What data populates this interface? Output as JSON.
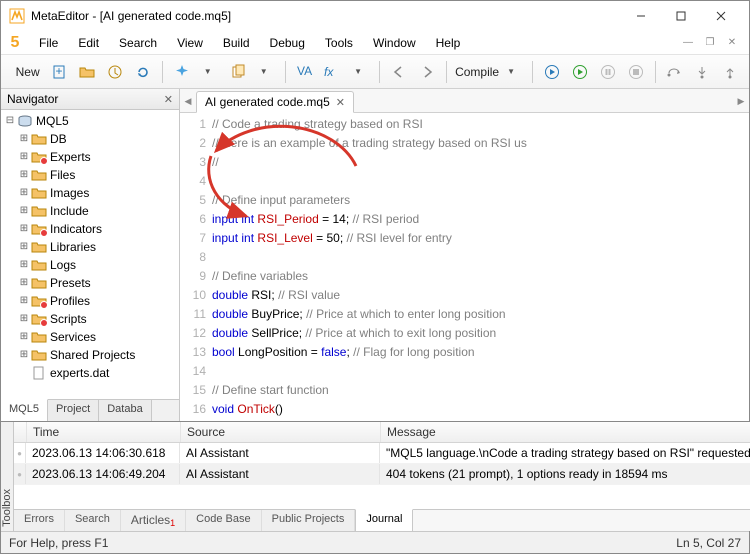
{
  "window": {
    "title": "MetaEditor - [AI generated code.mq5]"
  },
  "menus": {
    "file": "File",
    "edit": "Edit",
    "search": "Search",
    "view": "View",
    "build": "Build",
    "debug": "Debug",
    "tools": "Tools",
    "window": "Window",
    "help": "Help"
  },
  "toolbar": {
    "new": "New",
    "compile": "Compile"
  },
  "navigator": {
    "title": "Navigator",
    "root": "MQL5",
    "items": [
      {
        "label": "DB",
        "icon": "folder"
      },
      {
        "label": "Experts",
        "icon": "folder",
        "badge": true
      },
      {
        "label": "Files",
        "icon": "folder"
      },
      {
        "label": "Images",
        "icon": "folder"
      },
      {
        "label": "Include",
        "icon": "folder"
      },
      {
        "label": "Indicators",
        "icon": "folder",
        "badge": true
      },
      {
        "label": "Libraries",
        "icon": "folder"
      },
      {
        "label": "Logs",
        "icon": "folder"
      },
      {
        "label": "Presets",
        "icon": "folder"
      },
      {
        "label": "Profiles",
        "icon": "folder",
        "badge": true
      },
      {
        "label": "Scripts",
        "icon": "folder",
        "badge": true
      },
      {
        "label": "Services",
        "icon": "folder"
      },
      {
        "label": "Shared Projects",
        "icon": "folder-shared"
      },
      {
        "label": "experts.dat",
        "icon": "file"
      }
    ],
    "tabs": {
      "a": "MQL5",
      "b": "Project",
      "c": "Databa"
    }
  },
  "filetab": {
    "name": "AI generated code.mq5"
  },
  "code_lines": [
    {
      "n": 1,
      "segs": [
        {
          "t": "// Code a trading strategy based on RSI",
          "c": "comment"
        }
      ]
    },
    {
      "n": 2,
      "segs": [
        {
          "t": "// Here is an example of a trading strategy based on RSI us",
          "c": "comment"
        }
      ]
    },
    {
      "n": 3,
      "segs": [
        {
          "t": "//",
          "c": "comment"
        }
      ]
    },
    {
      "n": 4,
      "segs": []
    },
    {
      "n": 5,
      "segs": [
        {
          "t": "// Define input parameters",
          "c": "comment"
        }
      ]
    },
    {
      "n": 6,
      "segs": [
        {
          "t": "input",
          "c": "kw-blue"
        },
        {
          "t": " "
        },
        {
          "t": "int",
          "c": "kw-blue"
        },
        {
          "t": " "
        },
        {
          "t": "RSI_Period",
          "c": "kw-red"
        },
        {
          "t": " = "
        },
        {
          "t": "14",
          "c": "numlit"
        },
        {
          "t": "; "
        },
        {
          "t": "// RSI period",
          "c": "comment"
        }
      ]
    },
    {
      "n": 7,
      "segs": [
        {
          "t": "input",
          "c": "kw-blue"
        },
        {
          "t": " "
        },
        {
          "t": "int",
          "c": "kw-blue"
        },
        {
          "t": " "
        },
        {
          "t": "RSI_Level",
          "c": "kw-red"
        },
        {
          "t": " = "
        },
        {
          "t": "50",
          "c": "numlit"
        },
        {
          "t": "; "
        },
        {
          "t": "// RSI level for entry",
          "c": "comment"
        }
      ]
    },
    {
      "n": 8,
      "segs": []
    },
    {
      "n": 9,
      "segs": [
        {
          "t": "// Define variables",
          "c": "comment"
        }
      ]
    },
    {
      "n": 10,
      "segs": [
        {
          "t": "double",
          "c": "kw-blue"
        },
        {
          "t": " "
        },
        {
          "t": "RSI",
          "c": "identifier"
        },
        {
          "t": "; "
        },
        {
          "t": "// RSI value",
          "c": "comment"
        }
      ]
    },
    {
      "n": 11,
      "segs": [
        {
          "t": "double",
          "c": "kw-blue"
        },
        {
          "t": " "
        },
        {
          "t": "BuyPrice",
          "c": "identifier"
        },
        {
          "t": "; "
        },
        {
          "t": "// Price at which to enter long position",
          "c": "comment"
        }
      ]
    },
    {
      "n": 12,
      "segs": [
        {
          "t": "double",
          "c": "kw-blue"
        },
        {
          "t": " "
        },
        {
          "t": "SellPrice",
          "c": "identifier"
        },
        {
          "t": "; "
        },
        {
          "t": "// Price at which to exit long position",
          "c": "comment"
        }
      ]
    },
    {
      "n": 13,
      "segs": [
        {
          "t": "bool",
          "c": "kw-blue"
        },
        {
          "t": " "
        },
        {
          "t": "LongPosition",
          "c": "identifier"
        },
        {
          "t": " = "
        },
        {
          "t": "false",
          "c": "kw-blue"
        },
        {
          "t": "; "
        },
        {
          "t": "// Flag for long position",
          "c": "comment"
        }
      ]
    },
    {
      "n": 14,
      "segs": []
    },
    {
      "n": 15,
      "segs": [
        {
          "t": "// Define start function",
          "c": "comment"
        }
      ]
    },
    {
      "n": 16,
      "segs": [
        {
          "t": "void",
          "c": "kw-blue"
        },
        {
          "t": " "
        },
        {
          "t": "OnTick",
          "c": "kw-red"
        },
        {
          "t": "()",
          "c": "identifier"
        }
      ]
    }
  ],
  "journal": {
    "headers": {
      "time": "Time",
      "source": "Source",
      "message": "Message"
    },
    "rows": [
      {
        "time": "2023.06.13 14:06:30.618",
        "src": "AI Assistant",
        "msg": "\"MQL5 language.\\nCode a trading strategy based on RSI\" requested"
      },
      {
        "time": "2023.06.13 14:06:49.204",
        "src": "AI Assistant",
        "msg": "404 tokens (21 prompt), 1 options ready in 18594 ms"
      }
    ],
    "tabs": {
      "errors": "Errors",
      "search": "Search",
      "articles": "Articles",
      "codebase": "Code Base",
      "pubproj": "Public Projects",
      "journal": "Journal"
    },
    "side": "Toolbox"
  },
  "status": {
    "help": "For Help, press F1",
    "pos": "Ln 5, Col 27"
  }
}
